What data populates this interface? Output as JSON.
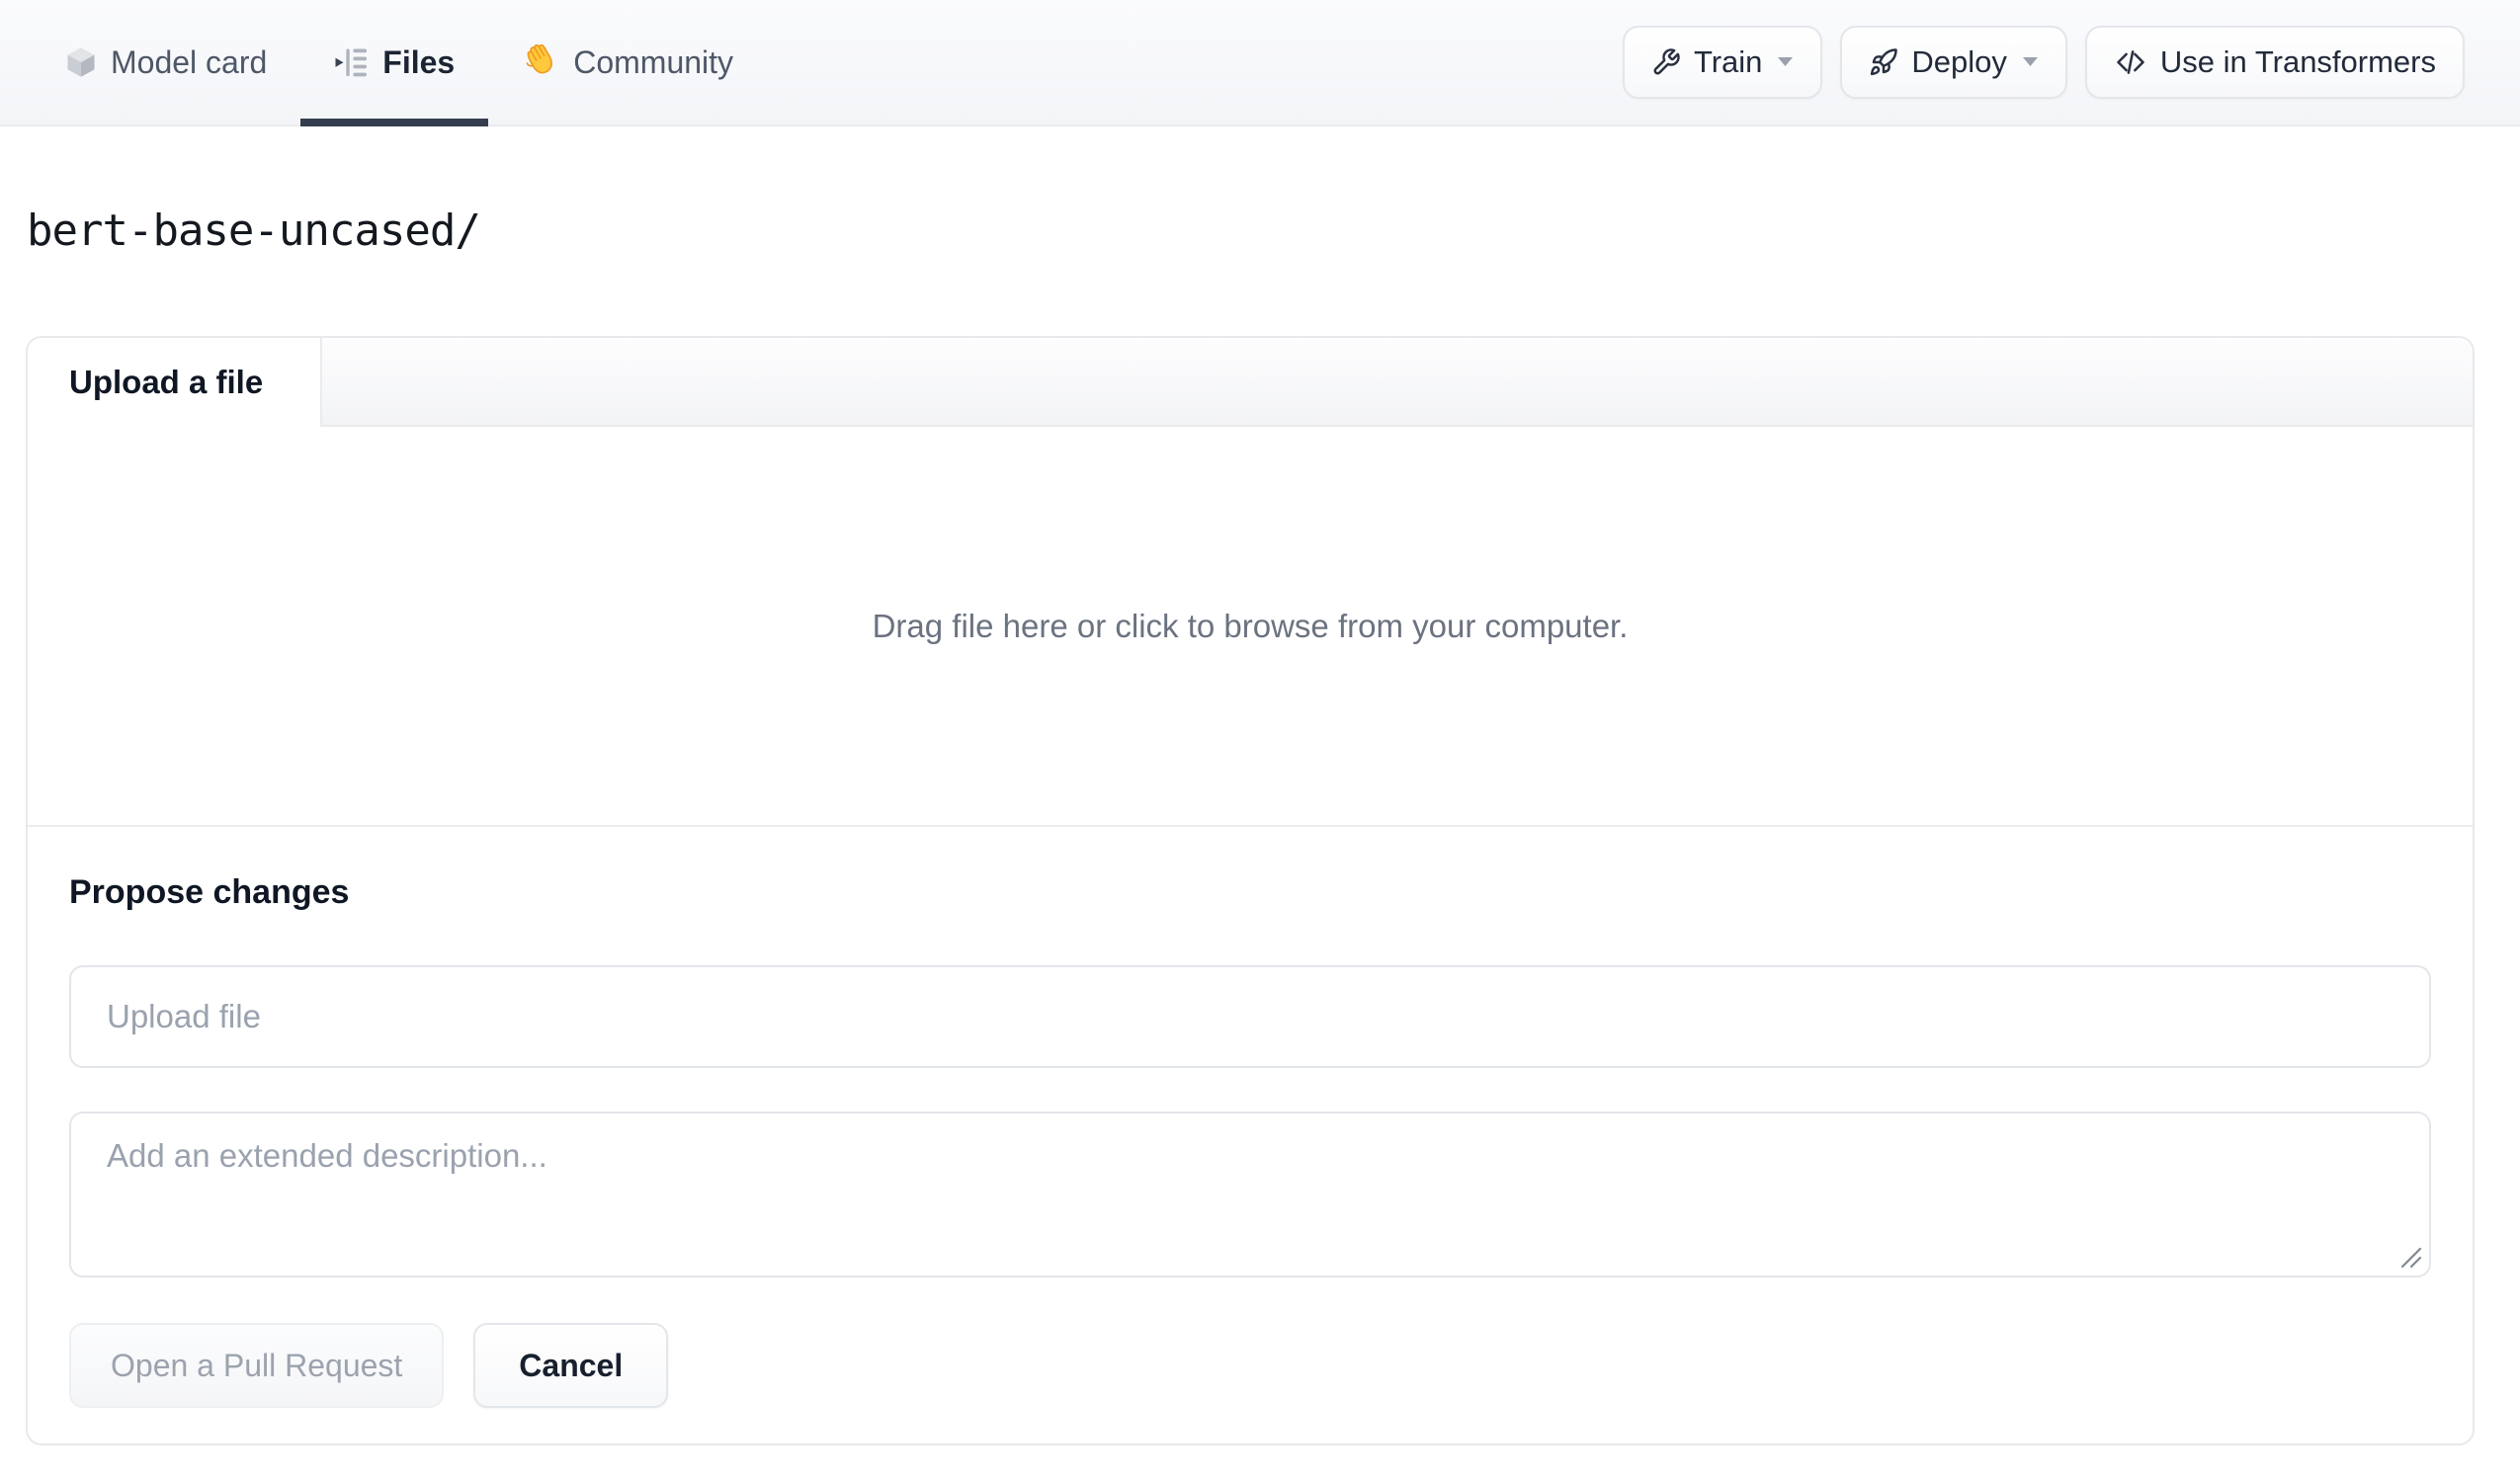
{
  "header": {
    "tabs": [
      {
        "label": "Model card",
        "icon": "cube-icon",
        "active": false
      },
      {
        "label": "Files",
        "icon": "file-tree-icon",
        "active": true
      },
      {
        "label": "Community",
        "icon": "waving-hand-icon",
        "active": false
      }
    ],
    "actions": [
      {
        "label": "Train",
        "icon": "wrench-icon",
        "has_dropdown": true
      },
      {
        "label": "Deploy",
        "icon": "rocket-icon",
        "has_dropdown": true
      },
      {
        "label": "Use in Transformers",
        "icon": "code-icon",
        "has_dropdown": false
      }
    ]
  },
  "breadcrumb": {
    "path": "bert-base-uncased/"
  },
  "upload_card": {
    "tab_label": "Upload a file",
    "dropzone_text": "Drag file here or click to browse from your computer.",
    "propose": {
      "heading": "Propose changes",
      "filename_placeholder": "Upload file",
      "description_placeholder": "Add an extended description...",
      "submit_label": "Open a Pull Request",
      "submit_disabled": true,
      "cancel_label": "Cancel"
    }
  },
  "colors": {
    "active_tab_underline": "#353e4f",
    "hand_icon_yellow": "#ffc83d",
    "disabled_button_text": "#9ca3ad",
    "placeholder_text": "#9aa2ae",
    "header_border": "#e9ebee"
  }
}
